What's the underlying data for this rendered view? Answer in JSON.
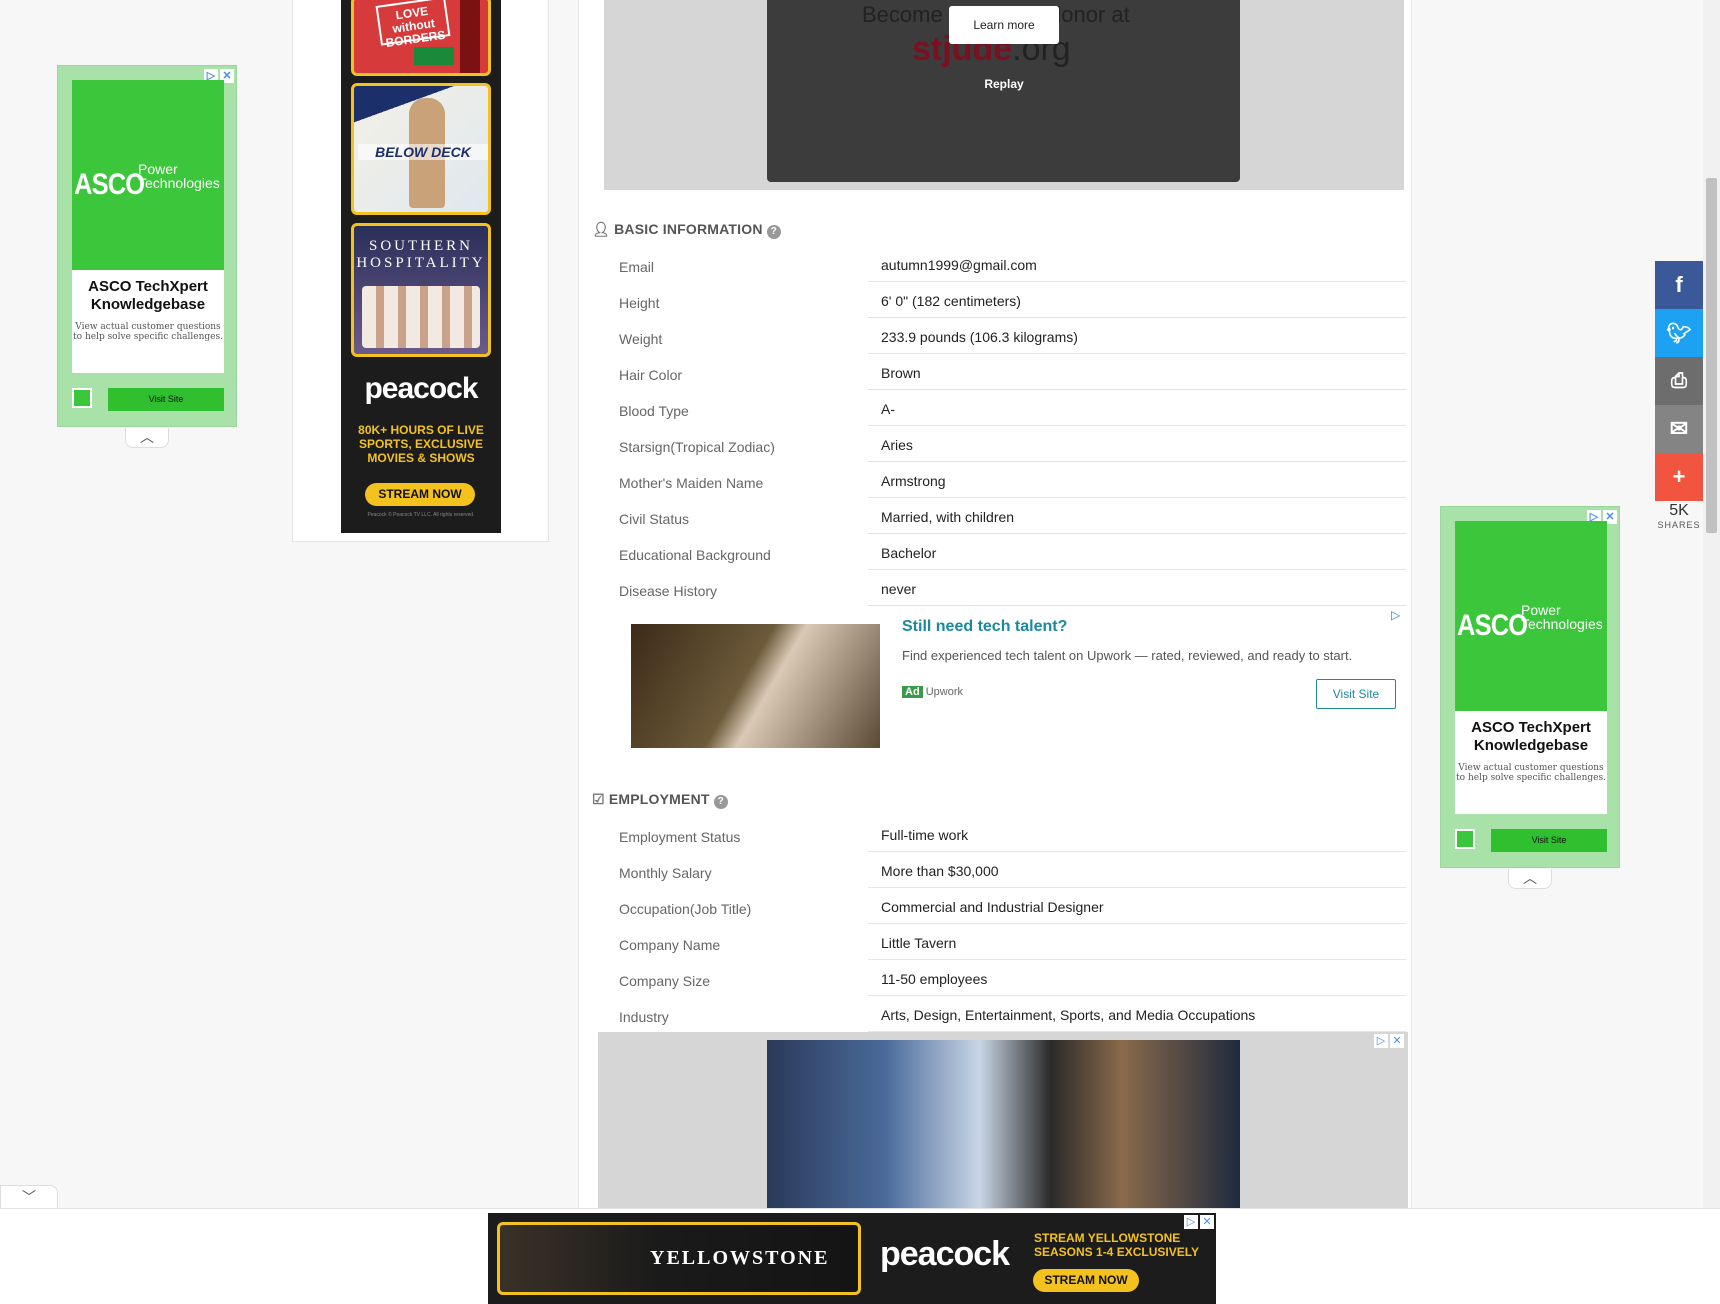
{
  "left_ad": {
    "brand_big": "ASCO",
    "brand_small_1": "Power",
    "brand_small_2": "Technologies",
    "title": "ASCO TechXpert Knowledgebase",
    "subtitle": "View actual customer questions to help solve specific challenges.",
    "button": "Visit Site"
  },
  "right_ad": {
    "brand_big": "ASCO",
    "brand_small_1": "Power",
    "brand_small_2": "Technologies",
    "title": "ASCO TechXpert Knowledgebase",
    "subtitle": "View actual customer questions to help solve specific challenges.",
    "button": "Visit Site"
  },
  "peacock_ad": {
    "tile1": "LOVE without BORDERS",
    "tile2": "BELOW DECK",
    "tile3_line1": "SOUTHERN",
    "tile3_line2": "HOSPITALITY",
    "logo": "peacock",
    "tagline": "80K+ HOURS OF LIVE SPORTS, EXCLUSIVE MOVIES & SHOWS",
    "cta": "STREAM NOW",
    "legal": "Peacock © Peacock TV LLC. All rights reserved."
  },
  "video_ad": {
    "text_before": "Become",
    "text_after": "donor at",
    "site_main": "stjude",
    "site_tld": ".org",
    "learn_more": "Learn more",
    "replay": "Replay"
  },
  "basic_info": {
    "title": "BASIC INFORMATION",
    "rows": [
      {
        "label": "Email",
        "value": "autumn1999@gmail.com"
      },
      {
        "label": "Height",
        "value": "6' 0\" (182 centimeters)"
      },
      {
        "label": "Weight",
        "value": "233.9 pounds (106.3 kilograms)"
      },
      {
        "label": "Hair Color",
        "value": "Brown"
      },
      {
        "label": "Blood Type",
        "value": "A-"
      },
      {
        "label": "Starsign(Tropical Zodiac)",
        "value": "Aries"
      },
      {
        "label": "Mother's Maiden Name",
        "value": "Armstrong"
      },
      {
        "label": "Civil Status",
        "value": "Married, with children"
      },
      {
        "label": "Educational Background",
        "value": "Bachelor"
      },
      {
        "label": "Disease History",
        "value": "never"
      }
    ]
  },
  "upwork_ad": {
    "headline": "Still need tech talent?",
    "body": "Find experienced tech talent on Upwork — rated, reviewed, and ready to start.",
    "badge": "Ad",
    "advertiser": "Upwork",
    "button": "Visit Site"
  },
  "employment": {
    "title": "EMPLOYMENT",
    "rows": [
      {
        "label": "Employment Status",
        "value": "Full-time work"
      },
      {
        "label": "Monthly Salary",
        "value": "More than $30,000"
      },
      {
        "label": "Occupation(Job Title)",
        "value": "Commercial and Industrial Designer"
      },
      {
        "label": "Company Name",
        "value": "Little Tavern"
      },
      {
        "label": "Company Size",
        "value": "11-50 employees"
      },
      {
        "label": "Industry",
        "value": "Arts, Design, Entertainment, Sports, and Media Occupations"
      }
    ]
  },
  "share": {
    "count": "5K",
    "label": "SHARES",
    "icons": [
      "facebook-icon",
      "twitter-icon",
      "print-icon",
      "email-icon",
      "plus-icon"
    ]
  },
  "bottom_ad": {
    "show": "YELLOWSTONE",
    "logo": "peacock",
    "tagline": "STREAM YELLOWSTONE SEASONS 1-4 EXCLUSIVELY",
    "cta": "STREAM NOW"
  },
  "colors": {
    "ad_green": "#3bc63b",
    "peacock_yellow": "#f3c21f",
    "facebook": "#3b5998",
    "twitter": "#1da1f2",
    "print": "#6d6d6d",
    "email": "#848484",
    "plus": "#f1543f",
    "link_teal": "#1a8a9c"
  }
}
